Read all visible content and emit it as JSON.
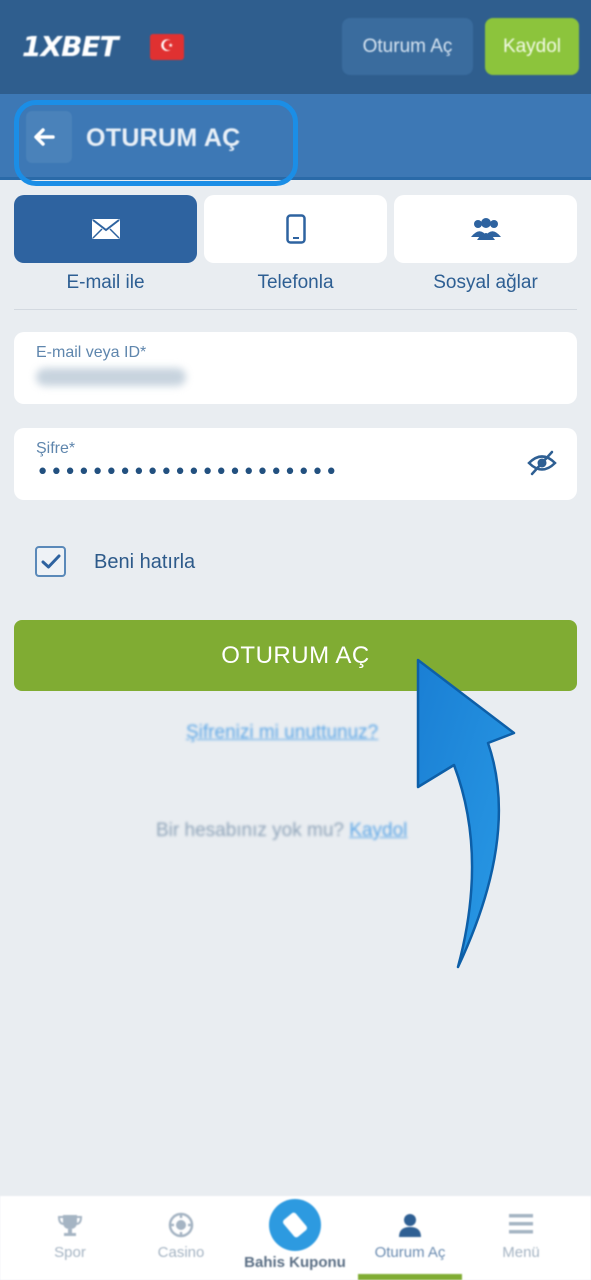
{
  "header": {
    "logo_text": "1XBET",
    "login_label": "Oturum Aç",
    "register_label": "Kaydol"
  },
  "subheader": {
    "title": "OTURUM AÇ"
  },
  "tabs": [
    {
      "label": "E-mail ile",
      "icon": "envelope-icon",
      "active": true
    },
    {
      "label": "Telefonla",
      "icon": "phone-icon",
      "active": false
    },
    {
      "label": "Sosyal ağlar",
      "icon": "users-icon",
      "active": false
    }
  ],
  "form": {
    "email_label": "E-mail veya ID*",
    "password_label": "Şifre*",
    "password_value": "••••••••••••••••••••••",
    "remember_label": "Beni hatırla",
    "remember_checked": true,
    "submit_label": "OTURUM AÇ",
    "forgot_label": "Şifrenizi mi unuttunuz?",
    "no_account_text": "Bir hesabınız yok mu?",
    "register_link": "Kaydol"
  },
  "bottom_nav": [
    {
      "label": "Spor",
      "icon": "trophy-icon"
    },
    {
      "label": "Casino",
      "icon": "casino-chip-icon"
    },
    {
      "label": "Bahis Kuponu",
      "icon": "ticket-icon"
    },
    {
      "label": "Oturum Aç",
      "icon": "user-icon",
      "active": true
    },
    {
      "label": "Menü",
      "icon": "menu-icon"
    }
  ],
  "colors": {
    "topbar": "#2f5e8e",
    "subbar": "#3d78b5",
    "accent_green": "#80ac33",
    "active_tab": "#2e63a0",
    "highlight_blue": "#1b8ee6"
  }
}
